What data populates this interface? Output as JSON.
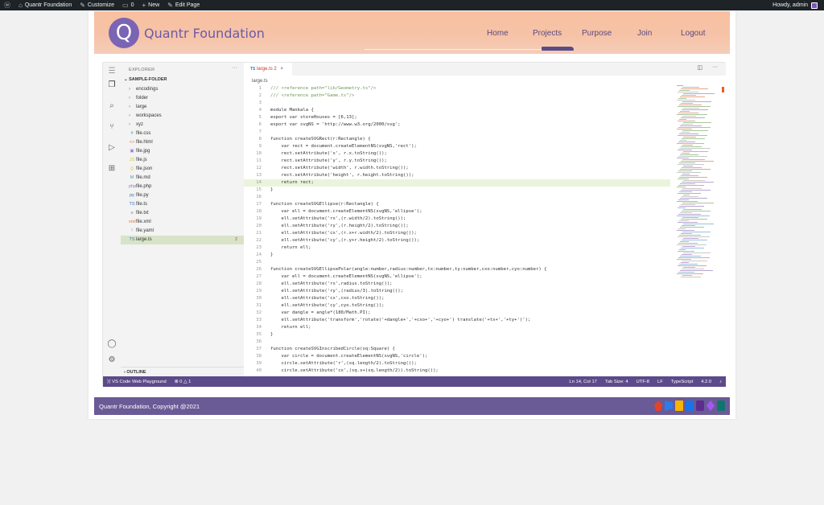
{
  "wpbar": {
    "site": "Quantr Foundation",
    "customize": "Customize",
    "comments": "0",
    "new": "New",
    "edit": "Edit Page",
    "howdy": "Howdy, admin"
  },
  "header": {
    "logo_letter": "Q",
    "title": "Quantr Foundation",
    "nav": [
      "Home",
      "Projects",
      "Purpose",
      "Join",
      "Logout"
    ]
  },
  "vscode": {
    "explorer_title": "EXPLORER",
    "explorer_more": "···",
    "folder": "SAMPLE-FOLDER",
    "tree": [
      {
        "type": "folder",
        "name": "encodings"
      },
      {
        "type": "folder",
        "name": "folder"
      },
      {
        "type": "folder",
        "name": "large"
      },
      {
        "type": "folder",
        "name": "workspaces"
      },
      {
        "type": "folder",
        "name": "xyz"
      },
      {
        "type": "file",
        "icon": "#",
        "name": "file.css",
        "color": "#519aba"
      },
      {
        "type": "file",
        "icon": "<>",
        "name": "file.html",
        "color": "#e37933"
      },
      {
        "type": "file",
        "icon": "▣",
        "name": "file.jpg",
        "color": "#a074c4"
      },
      {
        "type": "file",
        "icon": "JS",
        "name": "file.js",
        "color": "#cbcb41"
      },
      {
        "type": "file",
        "icon": "{}",
        "name": "file.json",
        "color": "#cbcb41"
      },
      {
        "type": "file",
        "icon": "M",
        "name": "file.md",
        "color": "#519aba"
      },
      {
        "type": "file",
        "icon": "php",
        "name": "file.php",
        "color": "#a074c4"
      },
      {
        "type": "file",
        "icon": "py",
        "name": "file.py",
        "color": "#3572a5"
      },
      {
        "type": "file",
        "icon": "TS",
        "name": "file.ts",
        "color": "#3178c6"
      },
      {
        "type": "file",
        "icon": "≡",
        "name": "file.txt",
        "color": "#6d8086"
      },
      {
        "type": "file",
        "icon": "xml",
        "name": "file.xml",
        "color": "#e37933"
      },
      {
        "type": "file",
        "icon": "!",
        "name": "file.yaml",
        "color": "#a074c4"
      },
      {
        "type": "file",
        "icon": "TS",
        "name": "large.ts",
        "color": "#3178c6",
        "selected": true,
        "badge": "2"
      }
    ],
    "outline": "OUTLINE",
    "tab": {
      "lang": "TS",
      "name": "large.ts",
      "count": "2",
      "close": "×"
    },
    "breadcrumb": "large.ts",
    "status": {
      "remote": "VS Code Web Playground",
      "problems": "⊗ 0 △ 1",
      "position": "Ln 14, Col 17",
      "tabsize": "Tab Size: 4",
      "encoding": "UTF-8",
      "eol": "LF",
      "language": "TypeScript",
      "version": "4.2.0",
      "bell": "🔔"
    },
    "code": [
      "/// <reference path=\"lib/Geometry.ts\"/>",
      "/// <reference path=\"Game.ts\"/>",
      "",
      "module Mankala {",
      "export var storeHouses = [6,13];",
      "export var svgNS = 'http://www.w3.org/2000/svg';",
      "",
      "function createSVGRect(r:Rectangle) {",
      "    var rect = document.createElementNS(svgNS,'rect');",
      "    rect.setAttribute('x', r.x.toString());",
      "    rect.setAttribute('y', r.y.toString());",
      "    rect.setAttribute('width', r.width.toString());",
      "    rect.setAttribute('height', r.height.toString());",
      "    return rect;",
      "}",
      "",
      "function createSVGEllipse(r:Rectangle) {",
      "    var ell = document.createElementNS(svgNS,'ellipse');",
      "    ell.setAttribute('rx',(r.width/2).toString());",
      "    ell.setAttribute('ry',(r.height/2).toString());",
      "    ell.setAttribute('cx',(r.x+r.width/2).toString());",
      "    ell.setAttribute('cy',(r.y+r.height/2).toString());",
      "    return ell;",
      "}",
      "",
      "function createSVGEllipsePolar(angle:number,radius:number,tx:number,ty:number,cxo:number,cyo:number) {",
      "    var ell = document.createElementNS(svgNS,'ellipse');",
      "    ell.setAttribute('rx',radius.toString());",
      "    ell.setAttribute('ry',(radius/3).toString());",
      "    ell.setAttribute('cx',cxo.toString());",
      "    ell.setAttribute('cy',cyo.toString());",
      "    var dangle = angle*(180/Math.PI);",
      "    ell.setAttribute('transform','rotate('+dangle+','+cxo+','+cyo+') translate('+tx+','+ty+')');",
      "    return ell;",
      "}",
      "",
      "function createSVGInscribedCircle(sq:Square) {",
      "    var circle = document.createElementNS(svgNS,'circle');",
      "    circle.setAttribute('r',(sq.length/2).toString());",
      "    circle.setAttribute('cx',(sq.x+(sq.length/2)).toString());"
    ],
    "highlight_line": 14
  },
  "footer": {
    "copyright": "Quantr Foundation, Copyright @2021"
  }
}
